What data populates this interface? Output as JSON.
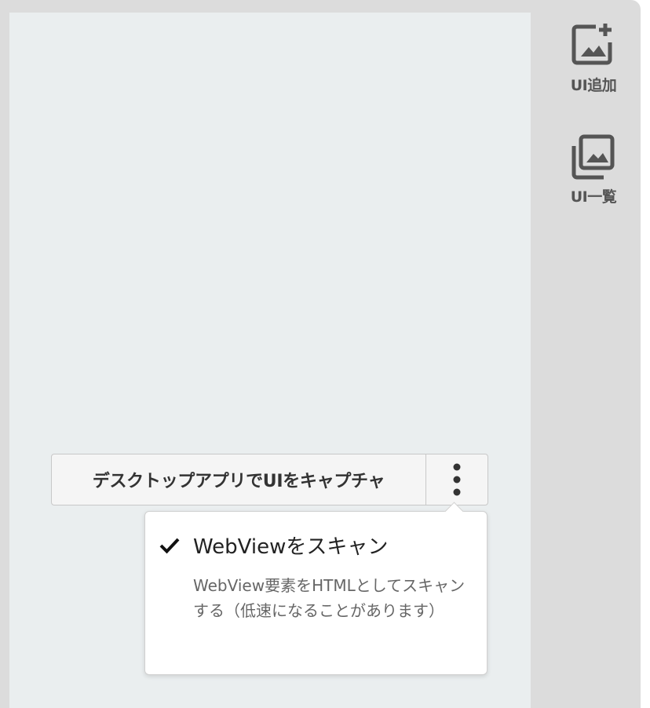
{
  "sidebar": {
    "items": [
      {
        "label": "UI追加",
        "icon": "add-image-icon"
      },
      {
        "label": "UI一覧",
        "icon": "image-library-icon"
      }
    ]
  },
  "capture": {
    "button_label": "デスクトップアプリでUIをキャプチャ",
    "more_icon": "vertical-dots-icon"
  },
  "menu": {
    "option_title": "WebViewをスキャン",
    "option_description": "WebView要素をHTMLとしてスキャンする（低速になることがあります）",
    "checked": true,
    "check_icon": "checkmark-icon"
  },
  "colors": {
    "background": "#dcdcdc",
    "panel": "#eaeeef",
    "icon": "#555555"
  }
}
